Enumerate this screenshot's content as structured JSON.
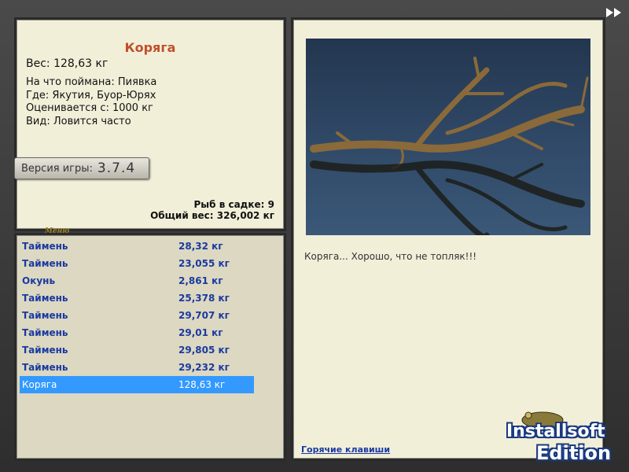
{
  "fish_info": {
    "title": "Коряга",
    "weight": "Вес: 128,63 кг",
    "caught_with": "На что поймана: Пиявка",
    "location": "Где: Якутия, Буор-Юрях",
    "valued_from": "Оценивается с: 1000 кг",
    "type": "Вид: Ловится часто"
  },
  "version": {
    "label": "Версия игры:",
    "number": "3.7.4"
  },
  "logo_text": "Меню",
  "stats": {
    "count": "Рыб в садке: 9",
    "total_weight": "Общий вес: 326,002 кг"
  },
  "catch_list": [
    {
      "name": "Таймень",
      "weight": "28,32 кг"
    },
    {
      "name": "Таймень",
      "weight": "23,055 кг"
    },
    {
      "name": "Окунь",
      "weight": "2,861 кг"
    },
    {
      "name": "Таймень",
      "weight": "25,378 кг"
    },
    {
      "name": "Таймень",
      "weight": "29,707 кг"
    },
    {
      "name": "Таймень",
      "weight": "29,01 кг"
    },
    {
      "name": "Таймень",
      "weight": "29,805 кг"
    },
    {
      "name": "Таймень",
      "weight": "29,232 кг"
    },
    {
      "name": "Коряга",
      "weight": "128,63 кг",
      "selected": true
    }
  ],
  "detail": {
    "description": "Коряга... Хорошо, что не топляк!!!",
    "hotkeys_link": "Горячие клавиши"
  },
  "watermark": {
    "line1": "Installsoft",
    "line2": "Edition"
  },
  "colors": {
    "panel_bg": "#f2efd9",
    "list_bg": "#dcd8c2",
    "title": "#c0502a",
    "link": "#1a3aa0",
    "selection": "#3399ff"
  }
}
